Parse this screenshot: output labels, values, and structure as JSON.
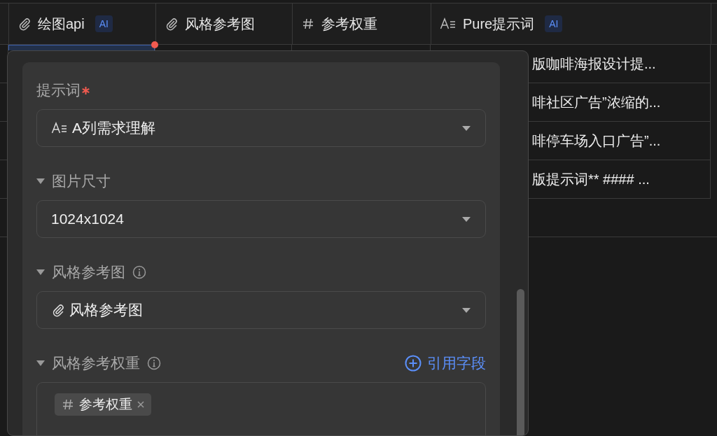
{
  "table": {
    "columns": [
      {
        "kind": "attachment",
        "label": "绘图api",
        "badge": "AI"
      },
      {
        "kind": "attachment",
        "label": "风格参考图"
      },
      {
        "kind": "number",
        "label": "参考权重"
      },
      {
        "kind": "text",
        "label": "Pure提示词",
        "badge": "AI"
      }
    ],
    "rows": [
      {
        "selected": true,
        "flagged": true,
        "prompt": "版咖啡海报设计提..."
      },
      {
        "selected": false,
        "flagged": false,
        "prompt": "啡社区广告”浓缩的..."
      },
      {
        "selected": false,
        "flagged": false,
        "prompt": "啡停车场入口广告”..."
      },
      {
        "selected": false,
        "flagged": false,
        "prompt": "版提示词** #### ..."
      }
    ]
  },
  "panel": {
    "fields": [
      {
        "kind": "select",
        "label": "提示词",
        "required": true,
        "value": {
          "kind": "text",
          "label": "A列需求理解"
        }
      },
      {
        "kind": "select",
        "label": "图片尺寸",
        "expanded": true,
        "value": {
          "kind": "plain",
          "label": "1024x1024"
        }
      },
      {
        "kind": "select",
        "label": "风格参考图",
        "expanded": true,
        "info": true,
        "value": {
          "kind": "attachment",
          "label": "风格参考图"
        }
      },
      {
        "kind": "tags",
        "label": "风格参考权重",
        "expanded": true,
        "info": true,
        "action": "引用字段",
        "tags": [
          {
            "kind": "number",
            "label": "参考权重"
          }
        ]
      }
    ]
  }
}
